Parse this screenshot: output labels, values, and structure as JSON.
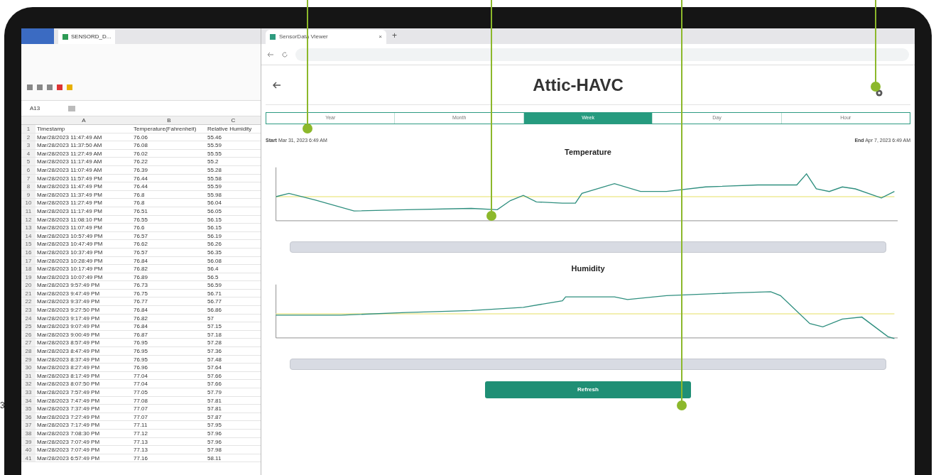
{
  "side_text": "3",
  "spreadsheet": {
    "tab_title": "SENSORD_D...",
    "name_box": "A13",
    "columns": [
      "A",
      "B",
      "C"
    ],
    "row_numbers": [
      "1",
      "2",
      "3",
      "4",
      "5",
      "6",
      "7",
      "8",
      "9",
      "10",
      "11",
      "12",
      "13",
      "14",
      "15",
      "16",
      "17",
      "18",
      "19",
      "20",
      "21",
      "22",
      "23",
      "24",
      "25",
      "26",
      "27",
      "28",
      "29",
      "30",
      "31",
      "32",
      "33",
      "34",
      "35",
      "36",
      "37",
      "38",
      "39",
      "40",
      "41"
    ],
    "header": [
      "Timestamp",
      "Temperature(Fahrenheit)",
      "Relative Humidity"
    ],
    "rows": [
      [
        "Mar/28/2023 11:47:49 AM",
        "76.06",
        "55.46"
      ],
      [
        "Mar/28/2023 11:37:50 AM",
        "76.08",
        "55.59"
      ],
      [
        "Mar/28/2023 11:27:49 AM",
        "76.02",
        "55.55"
      ],
      [
        "Mar/28/2023 11:17:49 AM",
        "76.22",
        "55.2"
      ],
      [
        "Mar/28/2023 11:07:49 AM",
        "76.39",
        "55.28"
      ],
      [
        "Mar/28/2023 11:57:49 PM",
        "76.44",
        "55.58"
      ],
      [
        "Mar/28/2023 11:47:49 PM",
        "76.44",
        "55.59"
      ],
      [
        "Mar/28/2023 11:37:49 PM",
        "76.8",
        "55.98"
      ],
      [
        "Mar/28/2023 11:27:49 PM",
        "76.8",
        "56.04"
      ],
      [
        "Mar/28/2023 11:17:49 PM",
        "76.51",
        "56.05"
      ],
      [
        "Mar/28/2023 11:08:10 PM",
        "76.55",
        "56.15"
      ],
      [
        "Mar/28/2023 11:07:49 PM",
        "76.6",
        "56.15"
      ],
      [
        "Mar/28/2023 10:57:49 PM",
        "76.57",
        "56.19"
      ],
      [
        "Mar/28/2023 10:47:49 PM",
        "76.62",
        "56.26"
      ],
      [
        "Mar/28/2023 10:37:49 PM",
        "76.57",
        "56.35"
      ],
      [
        "Mar/28/2023 10:28:49 PM",
        "76.84",
        "56.08"
      ],
      [
        "Mar/28/2023 10:17:49 PM",
        "76.82",
        "56.4"
      ],
      [
        "Mar/28/2023 10:07:49 PM",
        "76.89",
        "56.5"
      ],
      [
        "Mar/28/2023 9:57:49 PM",
        "76.73",
        "56.59"
      ],
      [
        "Mar/28/2023 9:47:49 PM",
        "76.75",
        "56.71"
      ],
      [
        "Mar/28/2023 9:37:49 PM",
        "76.77",
        "56.77"
      ],
      [
        "Mar/28/2023 9:27:50 PM",
        "76.84",
        "56.86"
      ],
      [
        "Mar/28/2023 9:17:49 PM",
        "76.82",
        "57"
      ],
      [
        "Mar/28/2023 9:07:49 PM",
        "76.84",
        "57.15"
      ],
      [
        "Mar/28/2023 9:00:49 PM",
        "76.87",
        "57.18"
      ],
      [
        "Mar/28/2023 8:57:49 PM",
        "76.95",
        "57.28"
      ],
      [
        "Mar/28/2023 8:47:49 PM",
        "76.95",
        "57.36"
      ],
      [
        "Mar/28/2023 8:37:49 PM",
        "76.95",
        "57.48"
      ],
      [
        "Mar/28/2023 8:27:49 PM",
        "76.96",
        "57.64"
      ],
      [
        "Mar/28/2023 8:17:49 PM",
        "77.04",
        "57.66"
      ],
      [
        "Mar/28/2023 8:07:50 PM",
        "77.04",
        "57.66"
      ],
      [
        "Mar/28/2023 7:57:49 PM",
        "77.05",
        "57.79"
      ],
      [
        "Mar/28/2023 7:47:49 PM",
        "77.08",
        "57.81"
      ],
      [
        "Mar/28/2023 7:37:49 PM",
        "77.07",
        "57.81"
      ],
      [
        "Mar/28/2023 7:27:49 PM",
        "77.07",
        "57.87"
      ],
      [
        "Mar/28/2023 7:17:49 PM",
        "77.11",
        "57.95"
      ],
      [
        "Mar/28/2023 7:08:30 PM",
        "77.12",
        "57.96"
      ],
      [
        "Mar/28/2023 7:07:49 PM",
        "77.13",
        "57.96"
      ],
      [
        "Mar/28/2023 7:07:49 PM",
        "77.13",
        "57.98"
      ],
      [
        "Mar/28/2023 6:57:49 PM",
        "77.16",
        "58.11"
      ]
    ]
  },
  "browser": {
    "tab_title": "SensorData Viewer",
    "close": "×",
    "new_tab": "+"
  },
  "page": {
    "title": "Attic-HAVC",
    "ranges": [
      {
        "label": "Year",
        "selected": false
      },
      {
        "label": "Month",
        "selected": false
      },
      {
        "label": "Week",
        "selected": true
      },
      {
        "label": "Day",
        "selected": false
      },
      {
        "label": "Hour",
        "selected": false
      }
    ],
    "start_label": "Start",
    "start_value": "Mar 31, 2023 6:49 AM",
    "end_label": "End",
    "end_value": "Apr 7, 2023 6:49 AM",
    "charts": [
      {
        "title": "Temperature"
      },
      {
        "title": "Humidity"
      }
    ],
    "refresh_button": "Refresh"
  }
}
